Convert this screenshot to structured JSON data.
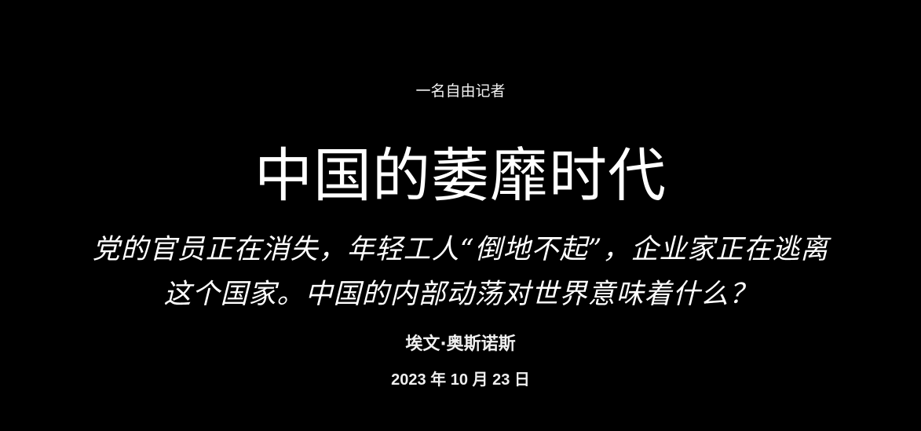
{
  "article": {
    "kicker": "一名自由记者",
    "headline": "中国的萎靡时代",
    "dek": "党的官员正在消失，年轻工人“倒地不起”，企业家正在逃离这个国家。中国的内部动荡对世界意味着什么？",
    "byline": "埃文·奥斯诺斯",
    "date": "2023 年 10 月 23 日"
  },
  "colors": {
    "background": "#000000",
    "text": "#ffffff"
  }
}
